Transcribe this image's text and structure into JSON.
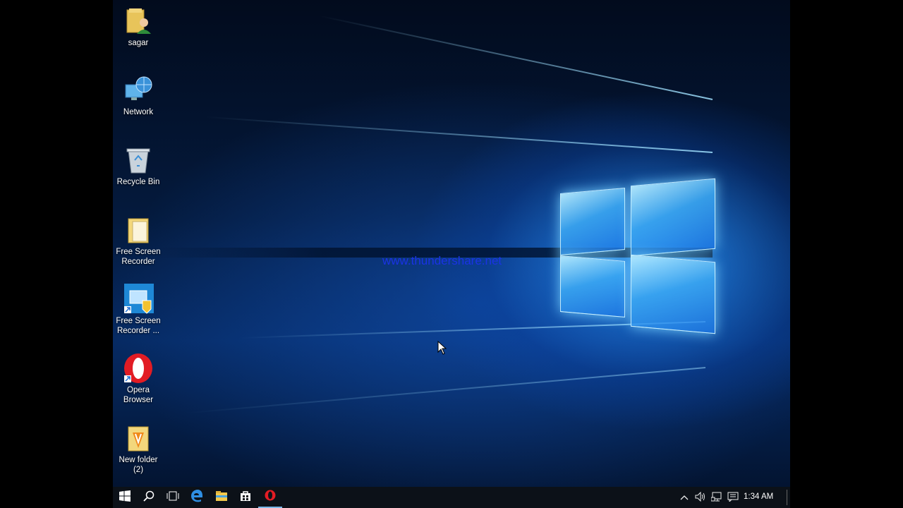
{
  "desktop": {
    "icons": [
      {
        "label": "sagar",
        "icon": "user-folder-icon"
      },
      {
        "label": "Network",
        "icon": "network-icon"
      },
      {
        "label": "Recycle Bin",
        "icon": "recycle-bin-icon"
      },
      {
        "label": "Free Screen Recorder",
        "icon": "folder-icon"
      },
      {
        "label": "Free Screen Recorder ...",
        "icon": "app-shortcut-icon"
      },
      {
        "label": "Opera Browser",
        "icon": "opera-icon"
      },
      {
        "label": "New folder (2)",
        "icon": "folder-icon"
      }
    ],
    "watermark": "www.thundershare.net"
  },
  "taskbar": {
    "items": [
      {
        "icon": "windows-start-icon"
      },
      {
        "icon": "search-icon"
      },
      {
        "icon": "task-view-icon"
      },
      {
        "icon": "edge-browser-icon"
      },
      {
        "icon": "file-explorer-icon"
      },
      {
        "icon": "store-icon"
      },
      {
        "icon": "opera-icon",
        "active": true
      }
    ],
    "tray": [
      "chevron-up-icon",
      "volume-icon",
      "network-tray-icon",
      "action-center-icon"
    ],
    "clock": "1:34 AM"
  },
  "colors": {
    "taskbar_bg": "#0c1118",
    "watermark": "#1a33e6",
    "accent": "#7cb8e8"
  }
}
